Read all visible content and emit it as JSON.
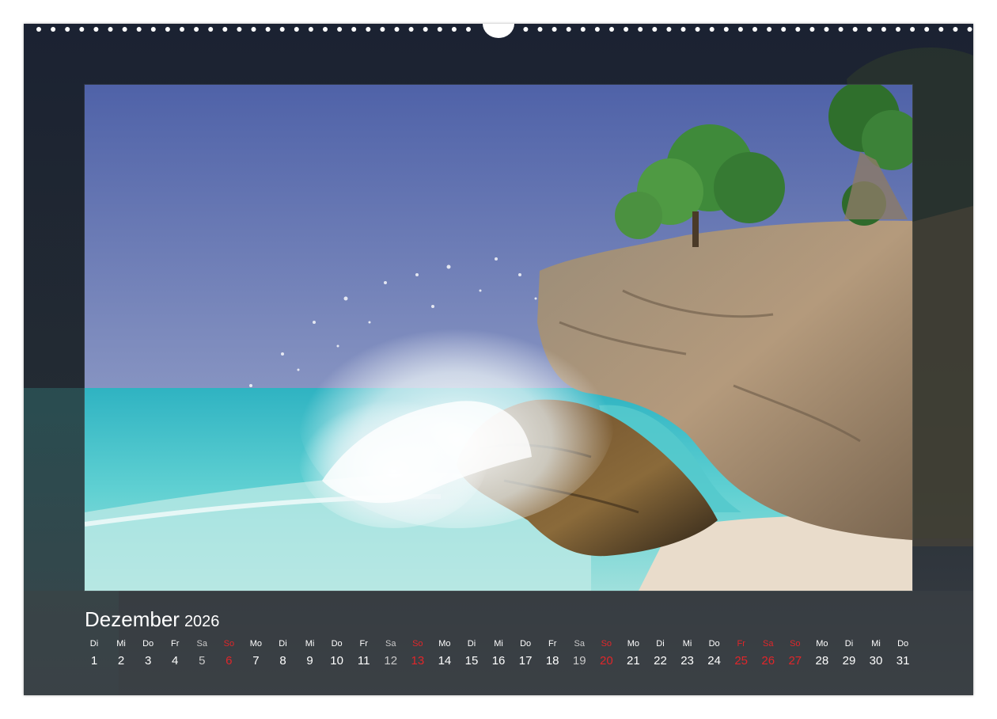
{
  "calendar": {
    "month": "Dezember",
    "year": "2026",
    "days": [
      {
        "wd": "Di",
        "d": "1",
        "kind": "normal"
      },
      {
        "wd": "Mi",
        "d": "2",
        "kind": "normal"
      },
      {
        "wd": "Do",
        "d": "3",
        "kind": "normal"
      },
      {
        "wd": "Fr",
        "d": "4",
        "kind": "normal"
      },
      {
        "wd": "Sa",
        "d": "5",
        "kind": "sat"
      },
      {
        "wd": "So",
        "d": "6",
        "kind": "red"
      },
      {
        "wd": "Mo",
        "d": "7",
        "kind": "normal"
      },
      {
        "wd": "Di",
        "d": "8",
        "kind": "normal"
      },
      {
        "wd": "Mi",
        "d": "9",
        "kind": "normal"
      },
      {
        "wd": "Do",
        "d": "10",
        "kind": "normal"
      },
      {
        "wd": "Fr",
        "d": "11",
        "kind": "normal"
      },
      {
        "wd": "Sa",
        "d": "12",
        "kind": "sat"
      },
      {
        "wd": "So",
        "d": "13",
        "kind": "red"
      },
      {
        "wd": "Mo",
        "d": "14",
        "kind": "normal"
      },
      {
        "wd": "Di",
        "d": "15",
        "kind": "normal"
      },
      {
        "wd": "Mi",
        "d": "16",
        "kind": "normal"
      },
      {
        "wd": "Do",
        "d": "17",
        "kind": "normal"
      },
      {
        "wd": "Fr",
        "d": "18",
        "kind": "normal"
      },
      {
        "wd": "Sa",
        "d": "19",
        "kind": "sat"
      },
      {
        "wd": "So",
        "d": "20",
        "kind": "red"
      },
      {
        "wd": "Mo",
        "d": "21",
        "kind": "normal"
      },
      {
        "wd": "Di",
        "d": "22",
        "kind": "normal"
      },
      {
        "wd": "Mi",
        "d": "23",
        "kind": "normal"
      },
      {
        "wd": "Do",
        "d": "24",
        "kind": "normal"
      },
      {
        "wd": "Fr",
        "d": "25",
        "kind": "red"
      },
      {
        "wd": "Sa",
        "d": "26",
        "kind": "red"
      },
      {
        "wd": "So",
        "d": "27",
        "kind": "red"
      },
      {
        "wd": "Mo",
        "d": "28",
        "kind": "normal"
      },
      {
        "wd": "Di",
        "d": "29",
        "kind": "normal"
      },
      {
        "wd": "Mi",
        "d": "30",
        "kind": "normal"
      },
      {
        "wd": "Do",
        "d": "31",
        "kind": "normal"
      }
    ]
  },
  "colors": {
    "weekday": "#ffffff",
    "saturday": "#c9c9c9",
    "holiday": "#e0262a",
    "sheet_top": "#1b2232",
    "sheet_bottom": "#3a3f45"
  },
  "photo": {
    "subject": "wave-crashing-on-coral-rock-beach"
  }
}
